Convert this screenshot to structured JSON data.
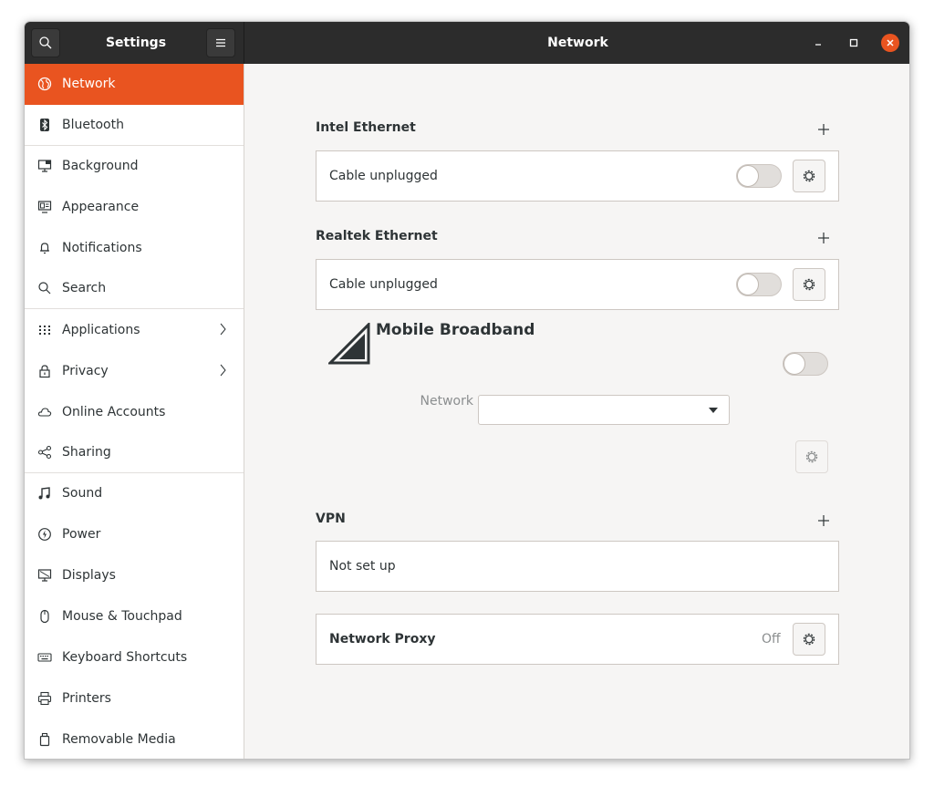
{
  "titlebar": {
    "app_title": "Settings",
    "page_title": "Network"
  },
  "sidebar": {
    "items": [
      {
        "label": "Network",
        "icon": "globe-icon"
      },
      {
        "label": "Bluetooth",
        "icon": "bluetooth-icon"
      },
      {
        "label": "Background",
        "icon": "monitor-image-icon"
      },
      {
        "label": "Appearance",
        "icon": "appearance-icon"
      },
      {
        "label": "Notifications",
        "icon": "bell-icon"
      },
      {
        "label": "Search",
        "icon": "search-icon"
      },
      {
        "label": "Applications",
        "icon": "apps-grid-icon"
      },
      {
        "label": "Privacy",
        "icon": "lock-icon"
      },
      {
        "label": "Online Accounts",
        "icon": "cloud-icon"
      },
      {
        "label": "Sharing",
        "icon": "share-icon"
      },
      {
        "label": "Sound",
        "icon": "music-note-icon"
      },
      {
        "label": "Power",
        "icon": "power-icon"
      },
      {
        "label": "Displays",
        "icon": "display-icon"
      },
      {
        "label": "Mouse & Touchpad",
        "icon": "mouse-icon"
      },
      {
        "label": "Keyboard Shortcuts",
        "icon": "keyboard-icon"
      },
      {
        "label": "Printers",
        "icon": "printer-icon"
      },
      {
        "label": "Removable Media",
        "icon": "usb-drive-icon"
      }
    ]
  },
  "network": {
    "intel": {
      "title": "Intel Ethernet",
      "status": "Cable unplugged",
      "enabled": false
    },
    "realtek": {
      "title": "Realtek Ethernet",
      "status": "Cable unplugged",
      "enabled": false
    },
    "mobile": {
      "title": "Mobile Broadband",
      "network_label": "Network",
      "network_value": "",
      "enabled": false
    },
    "vpn": {
      "title": "VPN",
      "status": "Not set up"
    },
    "proxy": {
      "title": "Network Proxy",
      "status": "Off"
    }
  },
  "colors": {
    "accent": "#e95420",
    "headerbar": "#2c2c2c",
    "window_bg": "#f6f5f4"
  }
}
